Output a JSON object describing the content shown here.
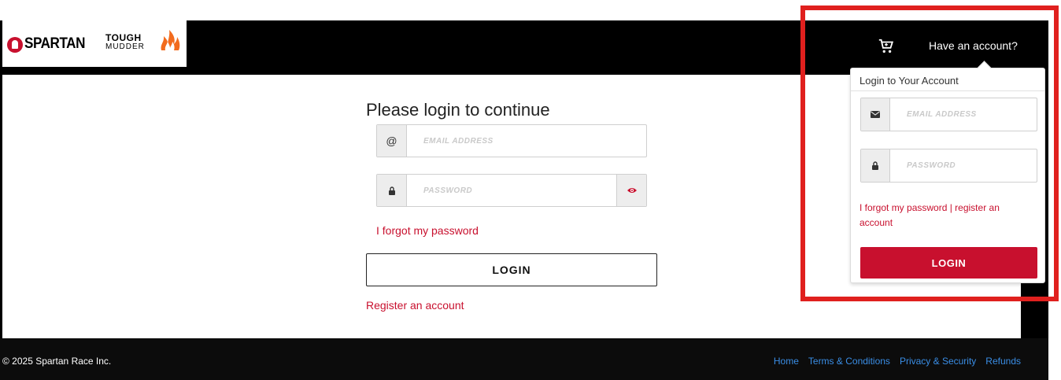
{
  "header": {
    "brand_spartan": "SPARTAN",
    "brand_tough": "TOUGH",
    "brand_mudder": "MUDDER",
    "have_account": "Have an account?",
    "cart_icon": "cart-icon"
  },
  "main": {
    "title": "Please login to continue",
    "email_placeholder": "EMAIL ADDRESS",
    "email_prefix": "@",
    "password_placeholder": "PASSWORD",
    "forgot_label": "I forgot my password",
    "login_label": "LOGIN",
    "register_label": "Register an account"
  },
  "dropdown": {
    "title": "Login to Your Account",
    "email_placeholder": "EMAIL ADDRESS",
    "password_placeholder": "PASSWORD",
    "forgot_label": "I forgot my password",
    "separator": " | ",
    "register_label": "register an account",
    "login_label": "LOGIN"
  },
  "footer": {
    "copyright": "© 2025 Spartan Race Inc.",
    "links": [
      "Home",
      "Terms & Conditions",
      "Privacy & Security",
      "Refunds"
    ]
  },
  "colors": {
    "accent_red": "#c8102e",
    "highlight_red": "#e0201e",
    "link_blue": "#3a8ee6",
    "header_bg": "#000000"
  }
}
